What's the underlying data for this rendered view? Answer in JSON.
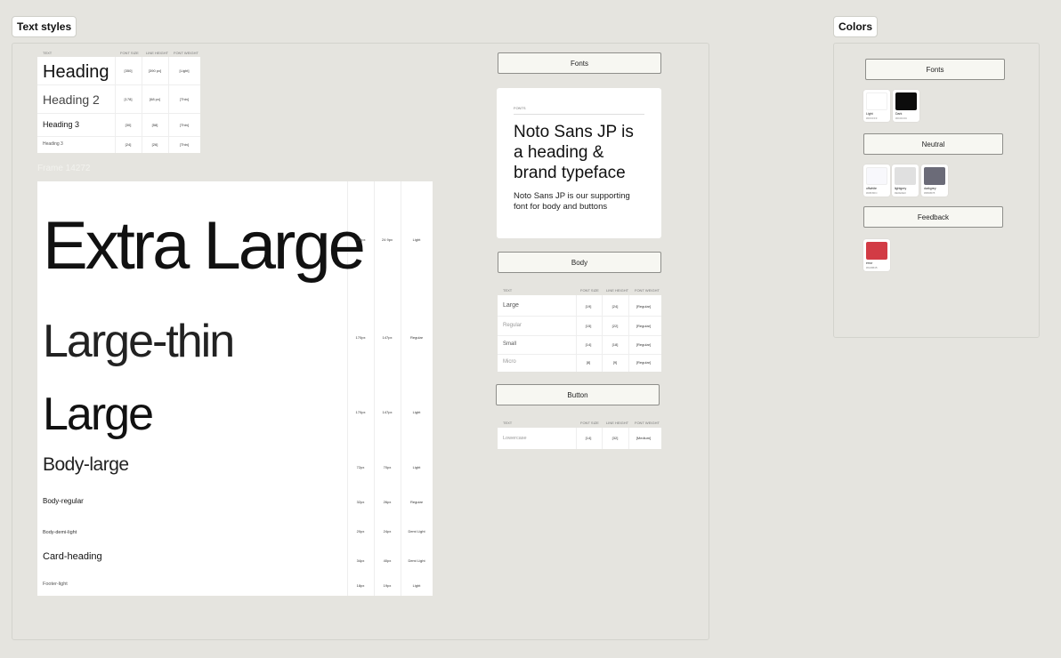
{
  "sections": {
    "text_styles": "Text styles",
    "colors": "Colors"
  },
  "headings_table": {
    "columns": [
      "TEXT",
      "FONT SIZE",
      "LINE HEIGHT",
      "FONT WEIGHT"
    ],
    "rows": [
      {
        "text": "Heading",
        "size": "[350]",
        "lh": "[390 px]",
        "weight": "[Light]"
      },
      {
        "text": "Heading 2",
        "size": "[178]",
        "lh": "[68 px]",
        "weight": "[Thin]"
      },
      {
        "text": "Heading 3",
        "size": "[30]",
        "lh": "[58]",
        "weight": "[Thin]"
      },
      {
        "text": "Heading 3",
        "size": "[24]",
        "lh": "[26]",
        "weight": "[Thin]"
      }
    ]
  },
  "frame_label": "Frame 14272",
  "big_table": {
    "rows": [
      {
        "text": "Extra Large",
        "size": "290px",
        "lh": "24 9px",
        "weight": "Light"
      },
      {
        "text": "Large-thin",
        "size": "170px",
        "lh": "147px",
        "weight": "Regular"
      },
      {
        "text": "Large",
        "size": "170px",
        "lh": "147px",
        "weight": "Light"
      },
      {
        "text": "Body-large",
        "size": "72px",
        "lh": "70px",
        "weight": "Light"
      },
      {
        "text": "Body-regular",
        "size": "32px",
        "lh": "26px",
        "weight": "Regular"
      },
      {
        "text": "Body-demi-light",
        "size": "20px",
        "lh": "24px",
        "weight": "Demi Light"
      },
      {
        "text": "Card-heading",
        "size": "34px",
        "lh": "40px",
        "weight": "Demi Light"
      },
      {
        "text": "Footer-light",
        "size": "18px",
        "lh": "19px",
        "weight": "Light"
      }
    ]
  },
  "fonts_header": "Fonts",
  "font_card": {
    "eyebrow": "FONTS",
    "headline": "Noto Sans JP is a heading & brand typeface",
    "body": "Noto Sans JP is our supporting font for body and buttons"
  },
  "body_header": "Body",
  "body_table": {
    "columns": [
      "TEXT",
      "FONT SIZE",
      "LINE HEIGHT",
      "FONT WEIGHT"
    ],
    "rows": [
      {
        "text": "Large",
        "size": "[19]",
        "lh": "[24]",
        "weight": "[Regular]"
      },
      {
        "text": "Regular",
        "size": "[15]",
        "lh": "[22]",
        "weight": "[Regular]"
      },
      {
        "text": "Small",
        "size": "[14]",
        "lh": "[18]",
        "weight": "[Regular]"
      },
      {
        "text": "Micro",
        "size": "[8]",
        "lh": "[9]",
        "weight": "[Regular]"
      }
    ]
  },
  "button_header": "Button",
  "button_table": {
    "columns": [
      "TEXT",
      "FONT SIZE",
      "LINE HEIGHT",
      "FONT WEIGHT"
    ],
    "rows": [
      {
        "text": "Lowercase",
        "size": "[14]",
        "lh": "[32]",
        "weight": "[Medium]"
      }
    ]
  },
  "colors_panel": {
    "fonts_header": "Fonts",
    "font_swatches": [
      {
        "name": "Light",
        "hex": "#FFFFFF",
        "color": "#ffffff"
      },
      {
        "name": "Dark",
        "hex": "#0C0C0C",
        "color": "#0c0c0c"
      }
    ],
    "neutral_header": "Neutral",
    "neutral_swatches": [
      {
        "name": "offwhite",
        "hex": "#F8F8FC",
        "color": "#f8f8fc"
      },
      {
        "name": "lightgrey",
        "hex": "#E0E0E0",
        "color": "#e0e0e0"
      },
      {
        "name": "darkgrey",
        "hex": "#6B6B78",
        "color": "#6b6b78"
      }
    ],
    "feedback_header": "Feedback",
    "feedback_swatches": [
      {
        "name": "error",
        "hex": "#D23B45",
        "color": "#d23b45"
      }
    ]
  }
}
